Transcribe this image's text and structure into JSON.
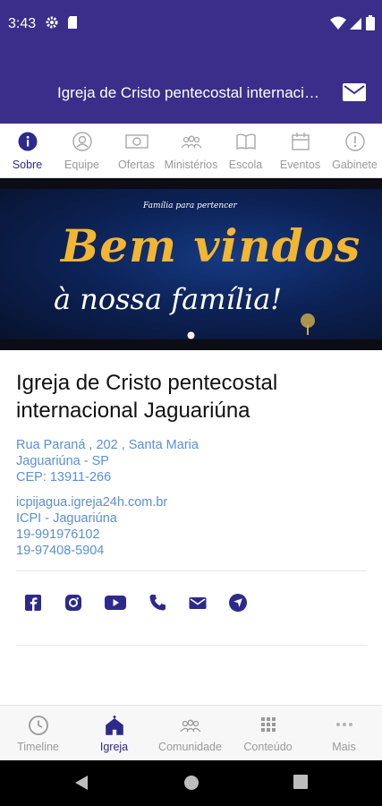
{
  "status": {
    "time": "3:43",
    "icons": [
      "settings-icon",
      "sd-card-icon",
      "wifi-icon",
      "signal-icon",
      "battery-icon"
    ]
  },
  "appbar": {
    "title": "Igreja de Cristo pentecostal internacional Jaguariúna",
    "action_icon": "mail-icon"
  },
  "tabs": [
    {
      "label": "Sobre",
      "icon": "info-icon",
      "active": true
    },
    {
      "label": "Equipe",
      "icon": "person-icon"
    },
    {
      "label": "Ofertas",
      "icon": "money-icon"
    },
    {
      "label": "Ministérios",
      "icon": "group-icon"
    },
    {
      "label": "Escola",
      "icon": "book-icon"
    },
    {
      "label": "Eventos",
      "icon": "calendar-icon"
    },
    {
      "label": "Gabinete",
      "icon": "alert-icon"
    }
  ],
  "banner": {
    "small_text": "Família para pertencer",
    "line1": "Bem vindos",
    "line2": "à nossa família!"
  },
  "church": {
    "name": "Igreja de Cristo pentecostal internacional Jaguariúna",
    "address_line1": "Rua Paraná , 202 , Santa Maria",
    "address_line2": "Jaguariúna - SP",
    "cep": "CEP: 13911-266",
    "website": "icpijagua.igreja24h.com.br",
    "short_name": "ICPI - Jaguariúna",
    "phone1": "19-991976102",
    "phone2": "19-97408-5904"
  },
  "social": [
    "facebook-icon",
    "instagram-icon",
    "youtube-icon",
    "phone-icon",
    "email-icon",
    "navigation-icon"
  ],
  "bottom_nav": [
    {
      "label": "Timeline",
      "icon": "clock-icon"
    },
    {
      "label": "Igreja",
      "icon": "church-icon",
      "active": true
    },
    {
      "label": "Comunidade",
      "icon": "group-icon"
    },
    {
      "label": "Conteúdo",
      "icon": "grid-icon"
    },
    {
      "label": "Mais",
      "icon": "more-icon"
    }
  ],
  "colors": {
    "primary": "#3a2e8a",
    "active": "#2d2a8c",
    "link": "#5a8fd6",
    "banner_gold": "#f2b632"
  }
}
